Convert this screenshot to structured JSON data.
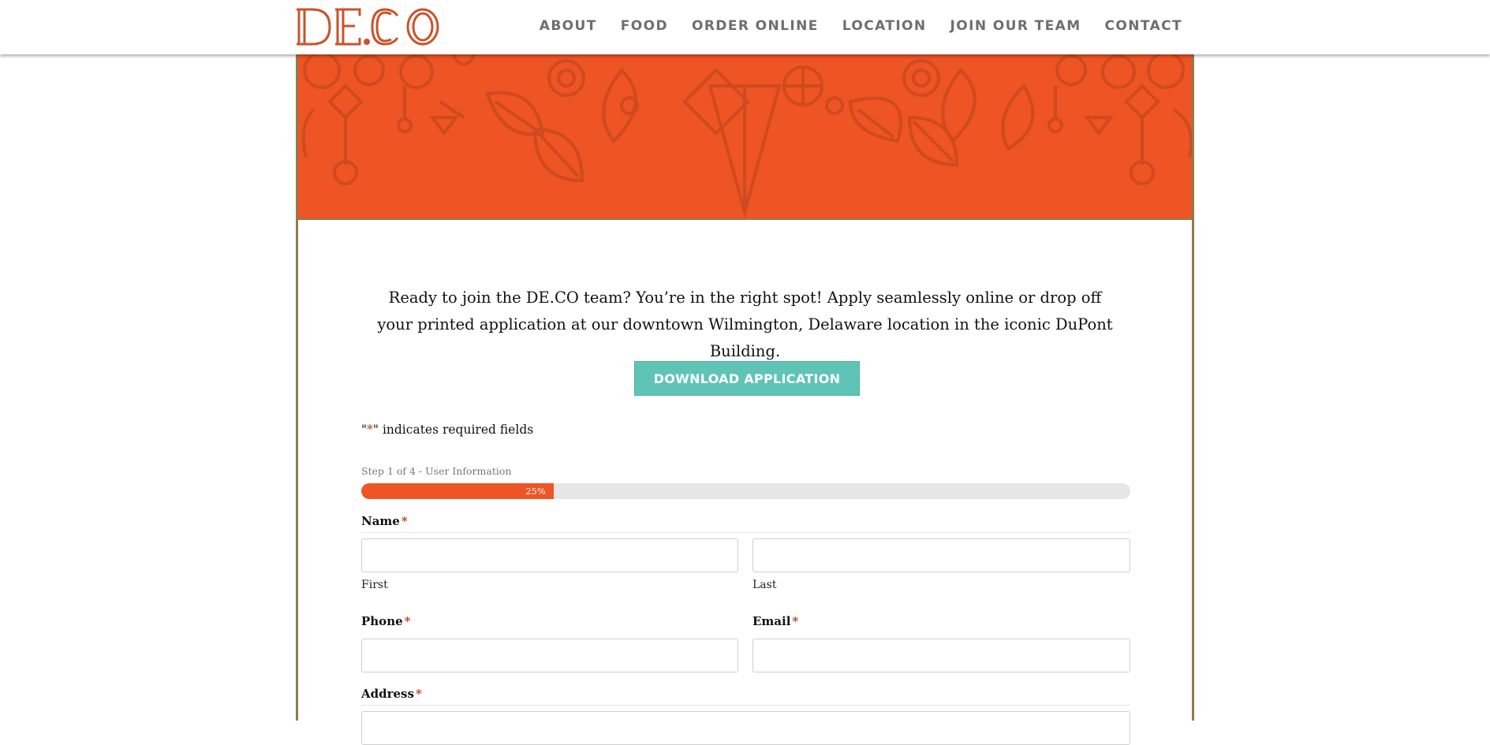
{
  "header": {
    "logo_text": "DE.CO",
    "nav": [
      {
        "label": "ABOUT"
      },
      {
        "label": "FOOD"
      },
      {
        "label": "ORDER ONLINE"
      },
      {
        "label": "LOCATION"
      },
      {
        "label": "JOIN OUR TEAM"
      },
      {
        "label": "CONTACT"
      }
    ]
  },
  "colors": {
    "brand_orange": "#ee5424",
    "button_teal": "#5fc4b6",
    "frame_border": "#8b7d4e",
    "nav_text": "#6e6e6e"
  },
  "main": {
    "intro": "Ready to join the DE.CO team? You’re in the right spot! Apply seamlessly online or drop off your printed application at our downtown Wilmington, Delaware location in the iconic DuPont Building.",
    "download_button": "DOWNLOAD APPLICATION"
  },
  "form": {
    "required_note_before": "\"",
    "required_star": "*",
    "required_note_after": "\" indicates required fields",
    "step_label": "Step 1 of 4 - User Information",
    "progress_label": "25%",
    "progress_fraction": 0.25,
    "name": {
      "label": "Name",
      "required_mark": "*",
      "first_value": "",
      "last_value": "",
      "first_sublabel": "First",
      "last_sublabel": "Last"
    },
    "phone": {
      "label": "Phone",
      "required_mark": "*",
      "value": ""
    },
    "email": {
      "label": "Email",
      "required_mark": "*",
      "value": ""
    },
    "address": {
      "label": "Address",
      "required_mark": "*",
      "value": ""
    }
  }
}
